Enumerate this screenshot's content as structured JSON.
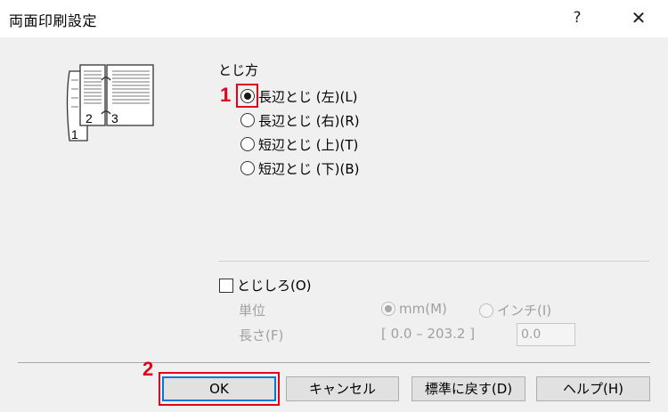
{
  "window": {
    "title": "両面印刷設定",
    "help_label": "?",
    "close_label": "✕"
  },
  "binding": {
    "group_label": "とじ方",
    "options": [
      {
        "label": "長辺とじ (左)(L)",
        "selected": true
      },
      {
        "label": "長辺とじ (右)(R)",
        "selected": false
      },
      {
        "label": "短辺とじ (上)(T)",
        "selected": false
      },
      {
        "label": "短辺とじ (下)(B)",
        "selected": false
      }
    ]
  },
  "preview": {
    "page_numbers": [
      "1",
      "2",
      "3"
    ]
  },
  "margin": {
    "checkbox_label": "とじしろ(O)",
    "unit_label": "単位",
    "unit_options": [
      {
        "label": "mm(M)",
        "selected": true
      },
      {
        "label": "インチ(I)",
        "selected": false
      }
    ],
    "length_label": "長さ(F)",
    "range_text": "[ 0.0 – 203.2 ]",
    "length_value": "0.0"
  },
  "buttons": {
    "ok": "OK",
    "cancel": "キャンセル",
    "reset": "標準に戻す(D)",
    "help": "ヘルプ(H)"
  },
  "annotations": {
    "step1": "1",
    "step2": "2"
  },
  "colors": {
    "highlight": "#e4001b",
    "focus": "#0078d7"
  }
}
